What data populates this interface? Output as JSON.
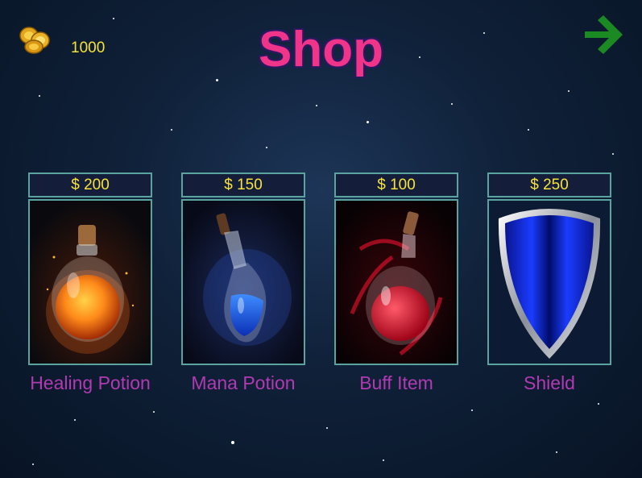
{
  "hud": {
    "gold": "1000",
    "coin_icon": "gold-coins-icon",
    "next_icon": "green-arrow-right-icon"
  },
  "title": "Shop",
  "colors": {
    "title": "#f0348a",
    "price_text": "#f7e23a",
    "item_label": "#b13ab3",
    "card_border": "#5aa39e",
    "arrow": "#1b8a23"
  },
  "items": [
    {
      "price": "$ 200",
      "name": "Healing Potion",
      "icon": "healing-potion-icon"
    },
    {
      "price": "$ 150",
      "name": "Mana Potion",
      "icon": "mana-potion-icon"
    },
    {
      "price": "$ 100",
      "name": "Buff Item",
      "icon": "buff-potion-icon"
    },
    {
      "price": "$ 250",
      "name": "Shield",
      "icon": "shield-icon"
    }
  ]
}
